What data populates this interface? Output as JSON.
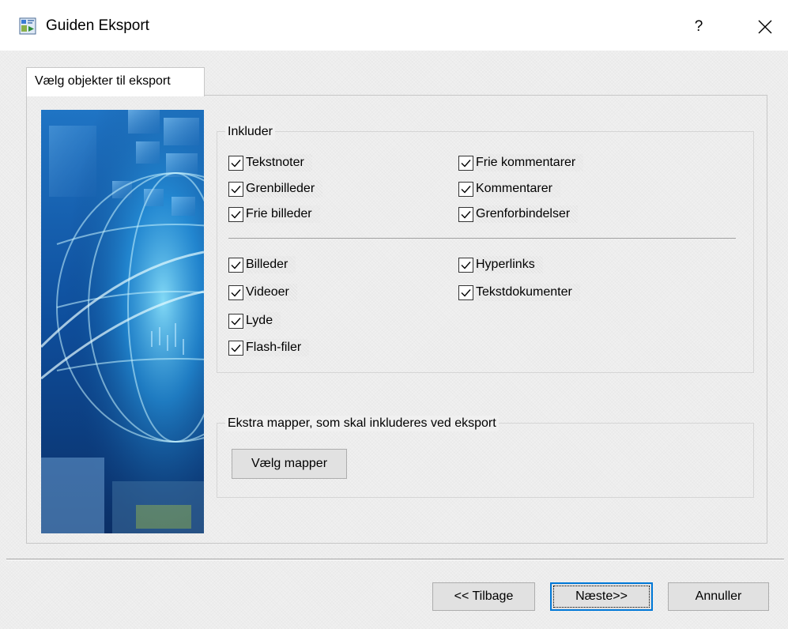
{
  "window": {
    "title": "Guiden Eksport",
    "help_label": "?",
    "app_icon": "export-wizard-icon",
    "close_icon": "close-icon"
  },
  "tab": {
    "label": "Vælg objekter til eksport"
  },
  "include_group": {
    "legend": "Inkluder",
    "checkboxes": [
      {
        "label": "Tekstnoter",
        "checked": true
      },
      {
        "label": "Frie kommentarer",
        "checked": true
      },
      {
        "label": "Grenbilleder",
        "checked": true
      },
      {
        "label": "Kommentarer",
        "checked": true
      },
      {
        "label": "Frie billeder",
        "checked": true
      },
      {
        "label": "Grenforbindelser",
        "checked": true
      },
      {
        "label": "Billeder",
        "checked": true
      },
      {
        "label": "Hyperlinks",
        "checked": true
      },
      {
        "label": "Videoer",
        "checked": true
      },
      {
        "label": "Tekstdokumenter",
        "checked": true
      },
      {
        "label": "Lyde",
        "checked": true
      },
      {
        "label": "Flash-filer",
        "checked": true
      }
    ]
  },
  "extra_group": {
    "legend": "Ekstra mapper, som skal inkluderes ved eksport",
    "button_label": "Vælg mapper"
  },
  "footer": {
    "back_label": "<< Tilbage",
    "next_label": "Næste>>",
    "cancel_label": "Annuller"
  },
  "colors": {
    "dialog_background": "#f0f0f0",
    "titlebar_background": "#ffffff",
    "focus_accent": "#0078d7",
    "button_face": "#e1e1e1"
  }
}
